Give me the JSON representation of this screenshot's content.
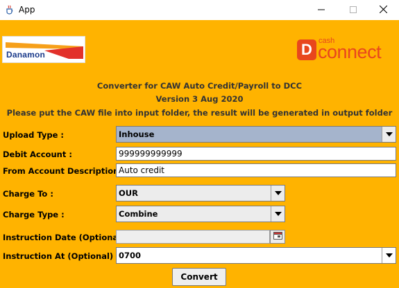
{
  "window": {
    "title": "App",
    "icon": "java-cup-icon",
    "controls": [
      "minimize-icon",
      "maximize-icon",
      "close-icon"
    ]
  },
  "logos": {
    "left_brand": "Danamon",
    "right_prefix": "cash",
    "right_word": "connect",
    "right_letter": "D"
  },
  "headings": {
    "line1": "Converter for CAW Auto Credit/Payroll to DCC",
    "line2": "Version 3 Aug 2020",
    "line3": "Please put the CAW file into input folder, the result will be generated in output folder"
  },
  "form": {
    "upload_type": {
      "label": "Upload Type :",
      "value": "Inhouse"
    },
    "debit_account": {
      "label": "Debit Account :",
      "value": "999999999999"
    },
    "from_account_description": {
      "label": "From Account Description :",
      "value": "Auto credit"
    },
    "charge_to": {
      "label": "Charge To :",
      "value": "OUR"
    },
    "charge_type": {
      "label": "Charge Type :",
      "value": "Combine"
    },
    "instruction_date": {
      "label": "Instruction Date (Optional) :",
      "value": ""
    },
    "instruction_at": {
      "label": "Instruction At (Optional) :",
      "value": "0700"
    }
  },
  "actions": {
    "convert_label": "Convert"
  },
  "colors": {
    "panel_background": "#ffb300",
    "cashconnect_orange": "#e8471d",
    "danamon_blue": "#1a3a8a",
    "selected_combo": "#a5b4cc"
  }
}
